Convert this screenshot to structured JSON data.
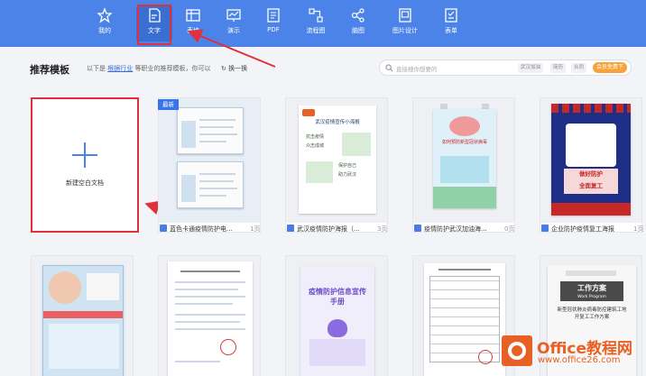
{
  "nav": [
    {
      "label": "我的",
      "icon": "star-icon"
    },
    {
      "label": "文字",
      "icon": "document-icon"
    },
    {
      "label": "表格",
      "icon": "table-icon"
    },
    {
      "label": "演示",
      "icon": "presentation-icon"
    },
    {
      "label": "PDF",
      "icon": "pdf-icon"
    },
    {
      "label": "流程图",
      "icon": "flowchart-icon"
    },
    {
      "label": "脑图",
      "icon": "mindmap-icon"
    },
    {
      "label": "图片设计",
      "icon": "image-design-icon"
    },
    {
      "label": "表单",
      "icon": "form-icon"
    }
  ],
  "heading": {
    "title": "推荐模板",
    "hint_prefix": "以下是",
    "hint_link": "根据行业",
    "hint_suffix": "等职业的推荐模板，你可以",
    "refresh_label": "换一换"
  },
  "search": {
    "placeholder": "直接搜你想要的",
    "tags": [
      "武汉加油",
      "简历",
      "合同"
    ],
    "vip_label": "会员免费下"
  },
  "new_blank": {
    "label": "新建空白文档"
  },
  "badge_new": "最新",
  "cards_row1": [
    {
      "title": "蓝色卡通疫情防护电...",
      "pages": "1页"
    },
    {
      "title": "武汉疫情防护海报（...",
      "pages": "3页"
    },
    {
      "title": "疫情防护武汉加油海...",
      "pages": "0页"
    },
    {
      "title": "企业防护疫情复工海报",
      "pages": "1页"
    }
  ],
  "posters": {
    "p2_title": "武汉疫情宣传小海报",
    "p2_lines": [
      "抗击疫情",
      "众志成城",
      "保护自己",
      "助力武汉"
    ],
    "p3_title": "如何预防新型冠状病毒",
    "p4_lines": [
      "做好防护",
      "全面复工"
    ],
    "r2_p3_title": "疫情防护信息宣传手册",
    "r2_p5_title": "工作方案",
    "r2_p5_sub": "Work Program",
    "r2_p5_desc": "新型冠状肺炎病毒防控建筑工地开复工工作方案"
  },
  "logo": {
    "brand": "Office教程网",
    "url": "www.office26.com"
  },
  "colors": {
    "nav_bg": "#4b83e8",
    "accent_red": "#e0303a",
    "brand_orange": "#e86024"
  }
}
